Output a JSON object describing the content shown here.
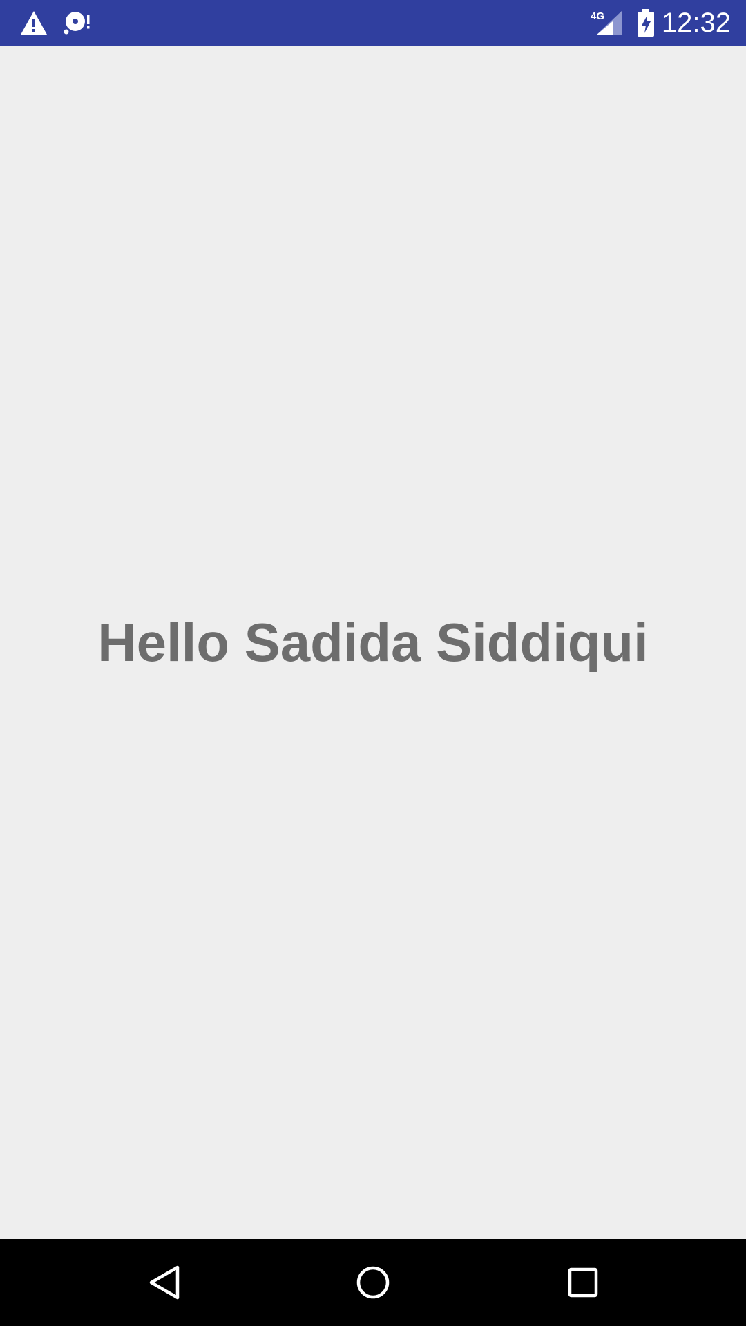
{
  "status_bar": {
    "time": "12:32",
    "network_type": "4G",
    "icons": [
      "warning-icon",
      "sd-card-alert-icon",
      "signal-icon",
      "battery-charging-icon"
    ],
    "background_color": "#303f9f"
  },
  "main": {
    "greeting": "Hello Sadida Siddiqui",
    "background_color": "#eeeeee",
    "text_color": "#6d6d6d"
  },
  "nav_bar": {
    "buttons": [
      "back-icon",
      "home-icon",
      "recents-icon"
    ],
    "background_color": "#000000"
  }
}
